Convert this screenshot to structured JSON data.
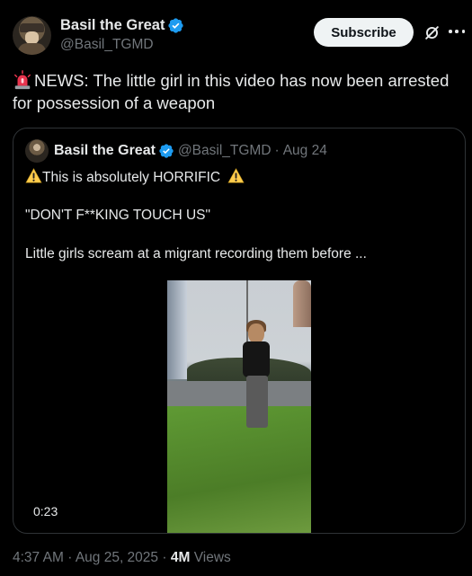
{
  "author": {
    "display_name": "Basil the Great",
    "handle": "@Basil_TGMD",
    "verified": true,
    "avatar_icon": "avatar"
  },
  "actions": {
    "subscribe_label": "Subscribe",
    "grok_icon": "grok-icon",
    "more_icon": "more-icon"
  },
  "tweet": {
    "text": "NEWS: The little girl in this video has now been arrested for possession of a weapon",
    "emoji_icon": "siren-icon"
  },
  "quote": {
    "display_name": "Basil the Great",
    "handle": "@Basil_TGMD",
    "separator": "·",
    "date": "Aug 24",
    "line1": "This is absolutely HORRIFIC",
    "line2": "\"DON'T F**KING TOUCH US\"",
    "line3": "Little girls scream at a migrant recording them before ...",
    "video_duration": "0:23"
  },
  "footer": {
    "time": "4:37 AM",
    "sep1": "·",
    "date": "Aug 25, 2025",
    "sep2": "·",
    "views_count": "4M",
    "views_label": "Views"
  },
  "colors": {
    "background": "#000000",
    "text": "#e7e9ea",
    "muted": "#71767b",
    "verified": "#1d9bf0",
    "border": "#2f3336",
    "subscribe_bg": "#eff3f4"
  }
}
